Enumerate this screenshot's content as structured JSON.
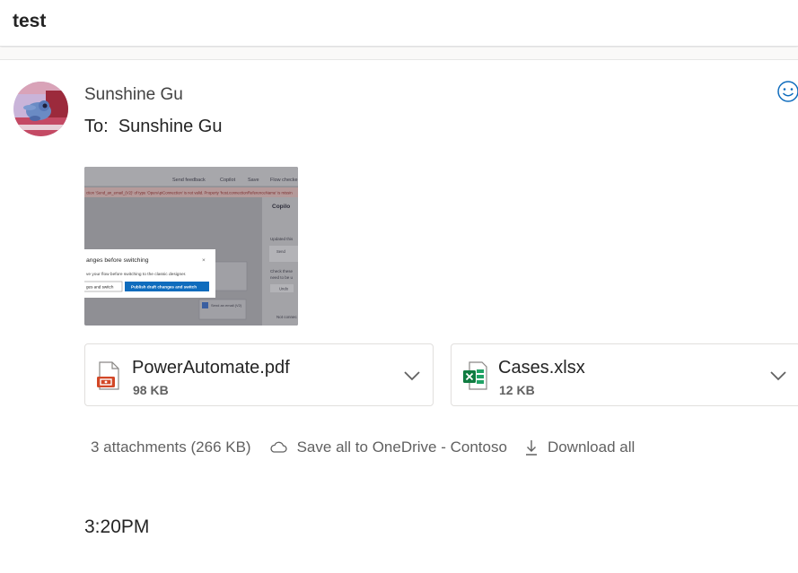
{
  "subject": "test",
  "message": {
    "sender": "Sunshine Gu",
    "to_label": "To:",
    "to_name": "Sunshine Gu",
    "time": "3:20PM"
  },
  "thumbnail": {
    "toolbar_items": [
      "Send feedback",
      "Copilot",
      "Save",
      "Flow checke"
    ],
    "error_text": "ction 'Send_an_email_(V2)' of type 'OpenApiConnection' is not valid. Property 'host.connectionReferenceName' is missin",
    "side_title": "Copilo",
    "side_lines": [
      "Updated this",
      "Send",
      "Check these",
      "need to be u",
      "Undo",
      "Not connec"
    ],
    "card_lines": [
      "Send an email (V2)",
      "Send an email (V2)"
    ],
    "dialog": {
      "title": "anges before switching",
      "body": "ve your flow before switching to the classic designer.",
      "secondary_button": "ges and switch",
      "primary_button": "Publish draft changes and switch",
      "close": "×"
    }
  },
  "attachments": [
    {
      "name": "PowerAutomate.pdf",
      "size": "98 KB",
      "icon": "pdf-file-icon",
      "color": "#d24726"
    },
    {
      "name": "Cases.xlsx",
      "size": "12 KB",
      "icon": "excel-file-icon",
      "color": "#107c41"
    }
  ],
  "actions": {
    "count": "3 attachments (266 KB)",
    "save_all": "Save all to OneDrive - Contoso",
    "download_all": "Download all"
  }
}
